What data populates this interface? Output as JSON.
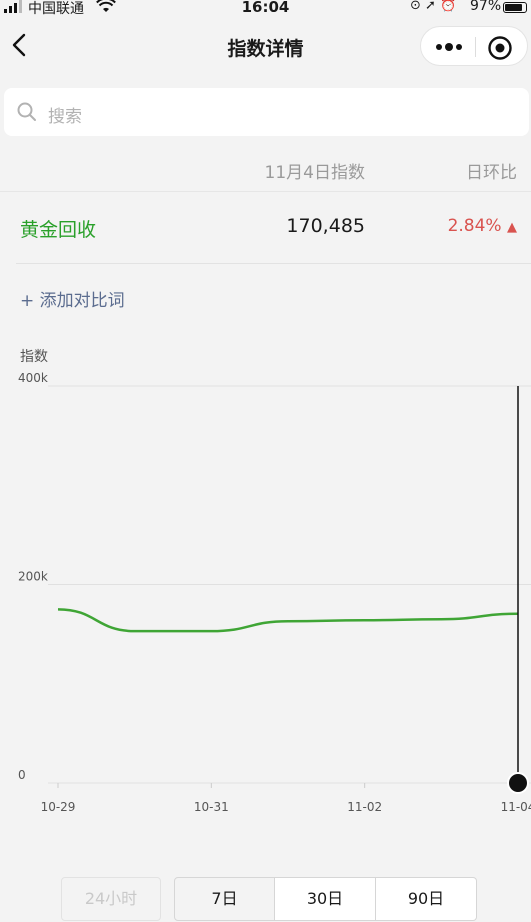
{
  "status_bar": {
    "carrier": "中国联通",
    "time": "16:04",
    "battery": "97%",
    "battery_level": 0.97
  },
  "nav": {
    "title": "指数详情"
  },
  "search": {
    "placeholder": "搜索"
  },
  "table": {
    "header_index": "11月4日指数",
    "header_change": "日环比",
    "rows": [
      {
        "keyword": "黄金回收",
        "value": "170,485",
        "change": "2.84%",
        "direction": "up"
      }
    ]
  },
  "add_compare": "+ 添加对比词",
  "colors": {
    "accent_green": "#2aa02a",
    "change_red": "#d9534f",
    "link_blue": "#5b6c8f"
  },
  "chart_data": {
    "type": "line",
    "ylabel": "指数",
    "yticks": [
      "400k",
      "200k",
      "0"
    ],
    "ylim": [
      0,
      400000
    ],
    "grid": true,
    "x": [
      "10-29",
      "10-30",
      "10-31",
      "11-01",
      "11-02",
      "11-03",
      "11-04"
    ],
    "xticks": [
      "10-29",
      "10-31",
      "11-02",
      "11-04"
    ],
    "series": [
      {
        "values": [
          175000,
          153000,
          153000,
          163000,
          164000,
          165000,
          170485
        ]
      }
    ]
  },
  "range_tabs": [
    {
      "label": "24小时",
      "state": "disabled"
    },
    {
      "label": "7日",
      "state": "active"
    },
    {
      "label": "30日",
      "state": "normal"
    },
    {
      "label": "90日",
      "state": "normal"
    }
  ]
}
